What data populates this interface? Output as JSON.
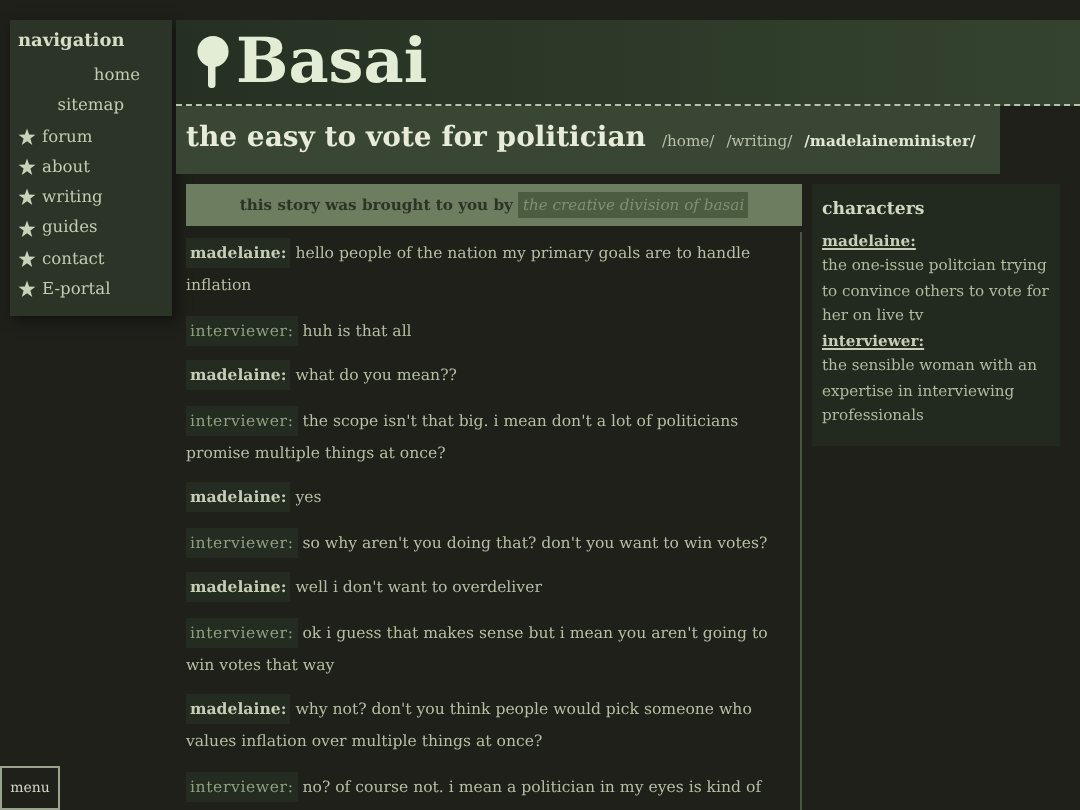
{
  "navigation": {
    "title": "navigation",
    "items": [
      {
        "label": "home",
        "starred": false
      },
      {
        "label": "sitemap",
        "starred": false
      },
      {
        "label": "forum",
        "starred": true
      },
      {
        "label": "about",
        "starred": true
      },
      {
        "label": "writing",
        "starred": true
      },
      {
        "label": "guides",
        "starred": true
      },
      {
        "label": "contact",
        "starred": true
      },
      {
        "label": "E-portal",
        "starred": true
      }
    ]
  },
  "site": {
    "name": "Basai"
  },
  "page": {
    "title": "the easy to vote for politician",
    "breadcrumbs": [
      {
        "label": "/home/",
        "selected": false
      },
      {
        "label": "/writing/",
        "selected": false
      },
      {
        "label": "/madelaineminister/",
        "selected": true
      }
    ]
  },
  "credit": {
    "text": "this story was brought to you by",
    "link": "the creative division of basai"
  },
  "dialogue": [
    {
      "kind": "lead",
      "speaker": "madelaine:",
      "text": "hello people of the nation my primary goals are to handle inflation"
    },
    {
      "kind": "host",
      "speaker": "interviewer:",
      "text": "huh is that all"
    },
    {
      "kind": "lead",
      "speaker": "madelaine:",
      "text": "what do you mean??"
    },
    {
      "kind": "host",
      "speaker": "interviewer:",
      "text": "the scope isn't that big. i mean don't a lot of politicians promise multiple things at once?"
    },
    {
      "kind": "lead",
      "speaker": "madelaine:",
      "text": "yes"
    },
    {
      "kind": "host",
      "speaker": "interviewer:",
      "text": "so why aren't you doing that? don't you want to win votes?"
    },
    {
      "kind": "lead",
      "speaker": "madelaine:",
      "text": "well i don't want to overdeliver"
    },
    {
      "kind": "host",
      "speaker": "interviewer:",
      "text": "ok i guess that makes sense but i mean you aren't going to win votes that way"
    },
    {
      "kind": "lead",
      "speaker": "madelaine:",
      "text": "why not? don't you think people would pick someone who values inflation over multiple things at once?"
    },
    {
      "kind": "host",
      "speaker": "interviewer:",
      "text": "no? of course not. i mean a politician in my eyes is kind of"
    }
  ],
  "characters": {
    "title": "characters",
    "items": [
      {
        "name": "madelaine:",
        "description": "the one-issue politcian trying to convince others to vote for her on live tv"
      },
      {
        "name": "interviewer:",
        "description": "the sensible woman with an expertise in interviewing professionals"
      }
    ]
  },
  "menu_button": "menu"
}
